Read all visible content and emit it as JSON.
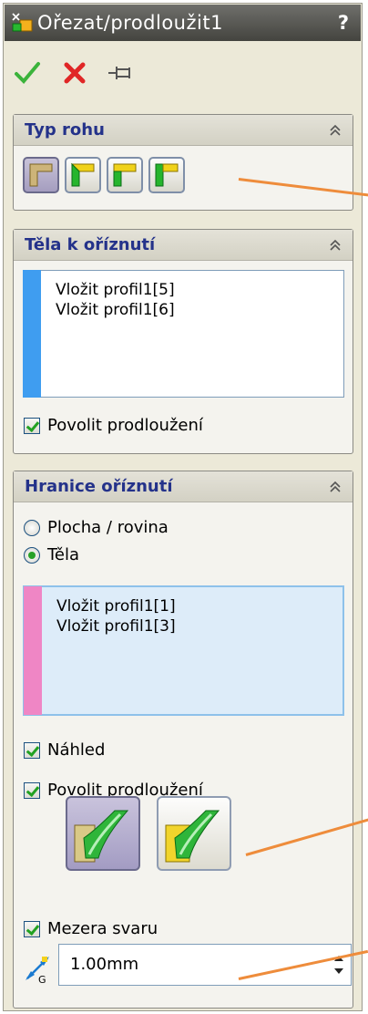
{
  "title": "Ořezat/prodloužit1",
  "help_label": "?",
  "toolbar": {
    "ok_icon": "check-icon",
    "cancel_icon": "cross-icon",
    "pin_icon": "pushpin-icon"
  },
  "corner_type": {
    "title": "Typ rohu",
    "buttons": [
      "corner-end-trim-icon",
      "corner-miter-icon",
      "corner-end-butt1-icon",
      "corner-end-butt2-icon"
    ]
  },
  "bodies_to_trim": {
    "title": "Těla k oříznutí",
    "items": [
      "Vložit profil1[5]",
      "Vložit profil1[6]"
    ],
    "allow_extension_label": "Povolit prodloužení",
    "list_color": "#3f9df0"
  },
  "trim_boundary": {
    "title": "Hranice oříznutí",
    "radio_face_label": "Plocha / rovina",
    "radio_bodies_label": "Těla",
    "items": [
      "Vložit profil1[1]",
      "Vložit profil1[3]"
    ],
    "list_color": "#ef86c5",
    "preview_label": "Náhled",
    "allow_extension_label": "Povolit prodloužení",
    "weld_gap_label": "Mezera svaru",
    "weld_gap_value": "1.00mm",
    "gap_icon": "weld-gap-icon"
  },
  "colors": {
    "accent": "#ee8c3b",
    "header_text": "#24328a"
  }
}
